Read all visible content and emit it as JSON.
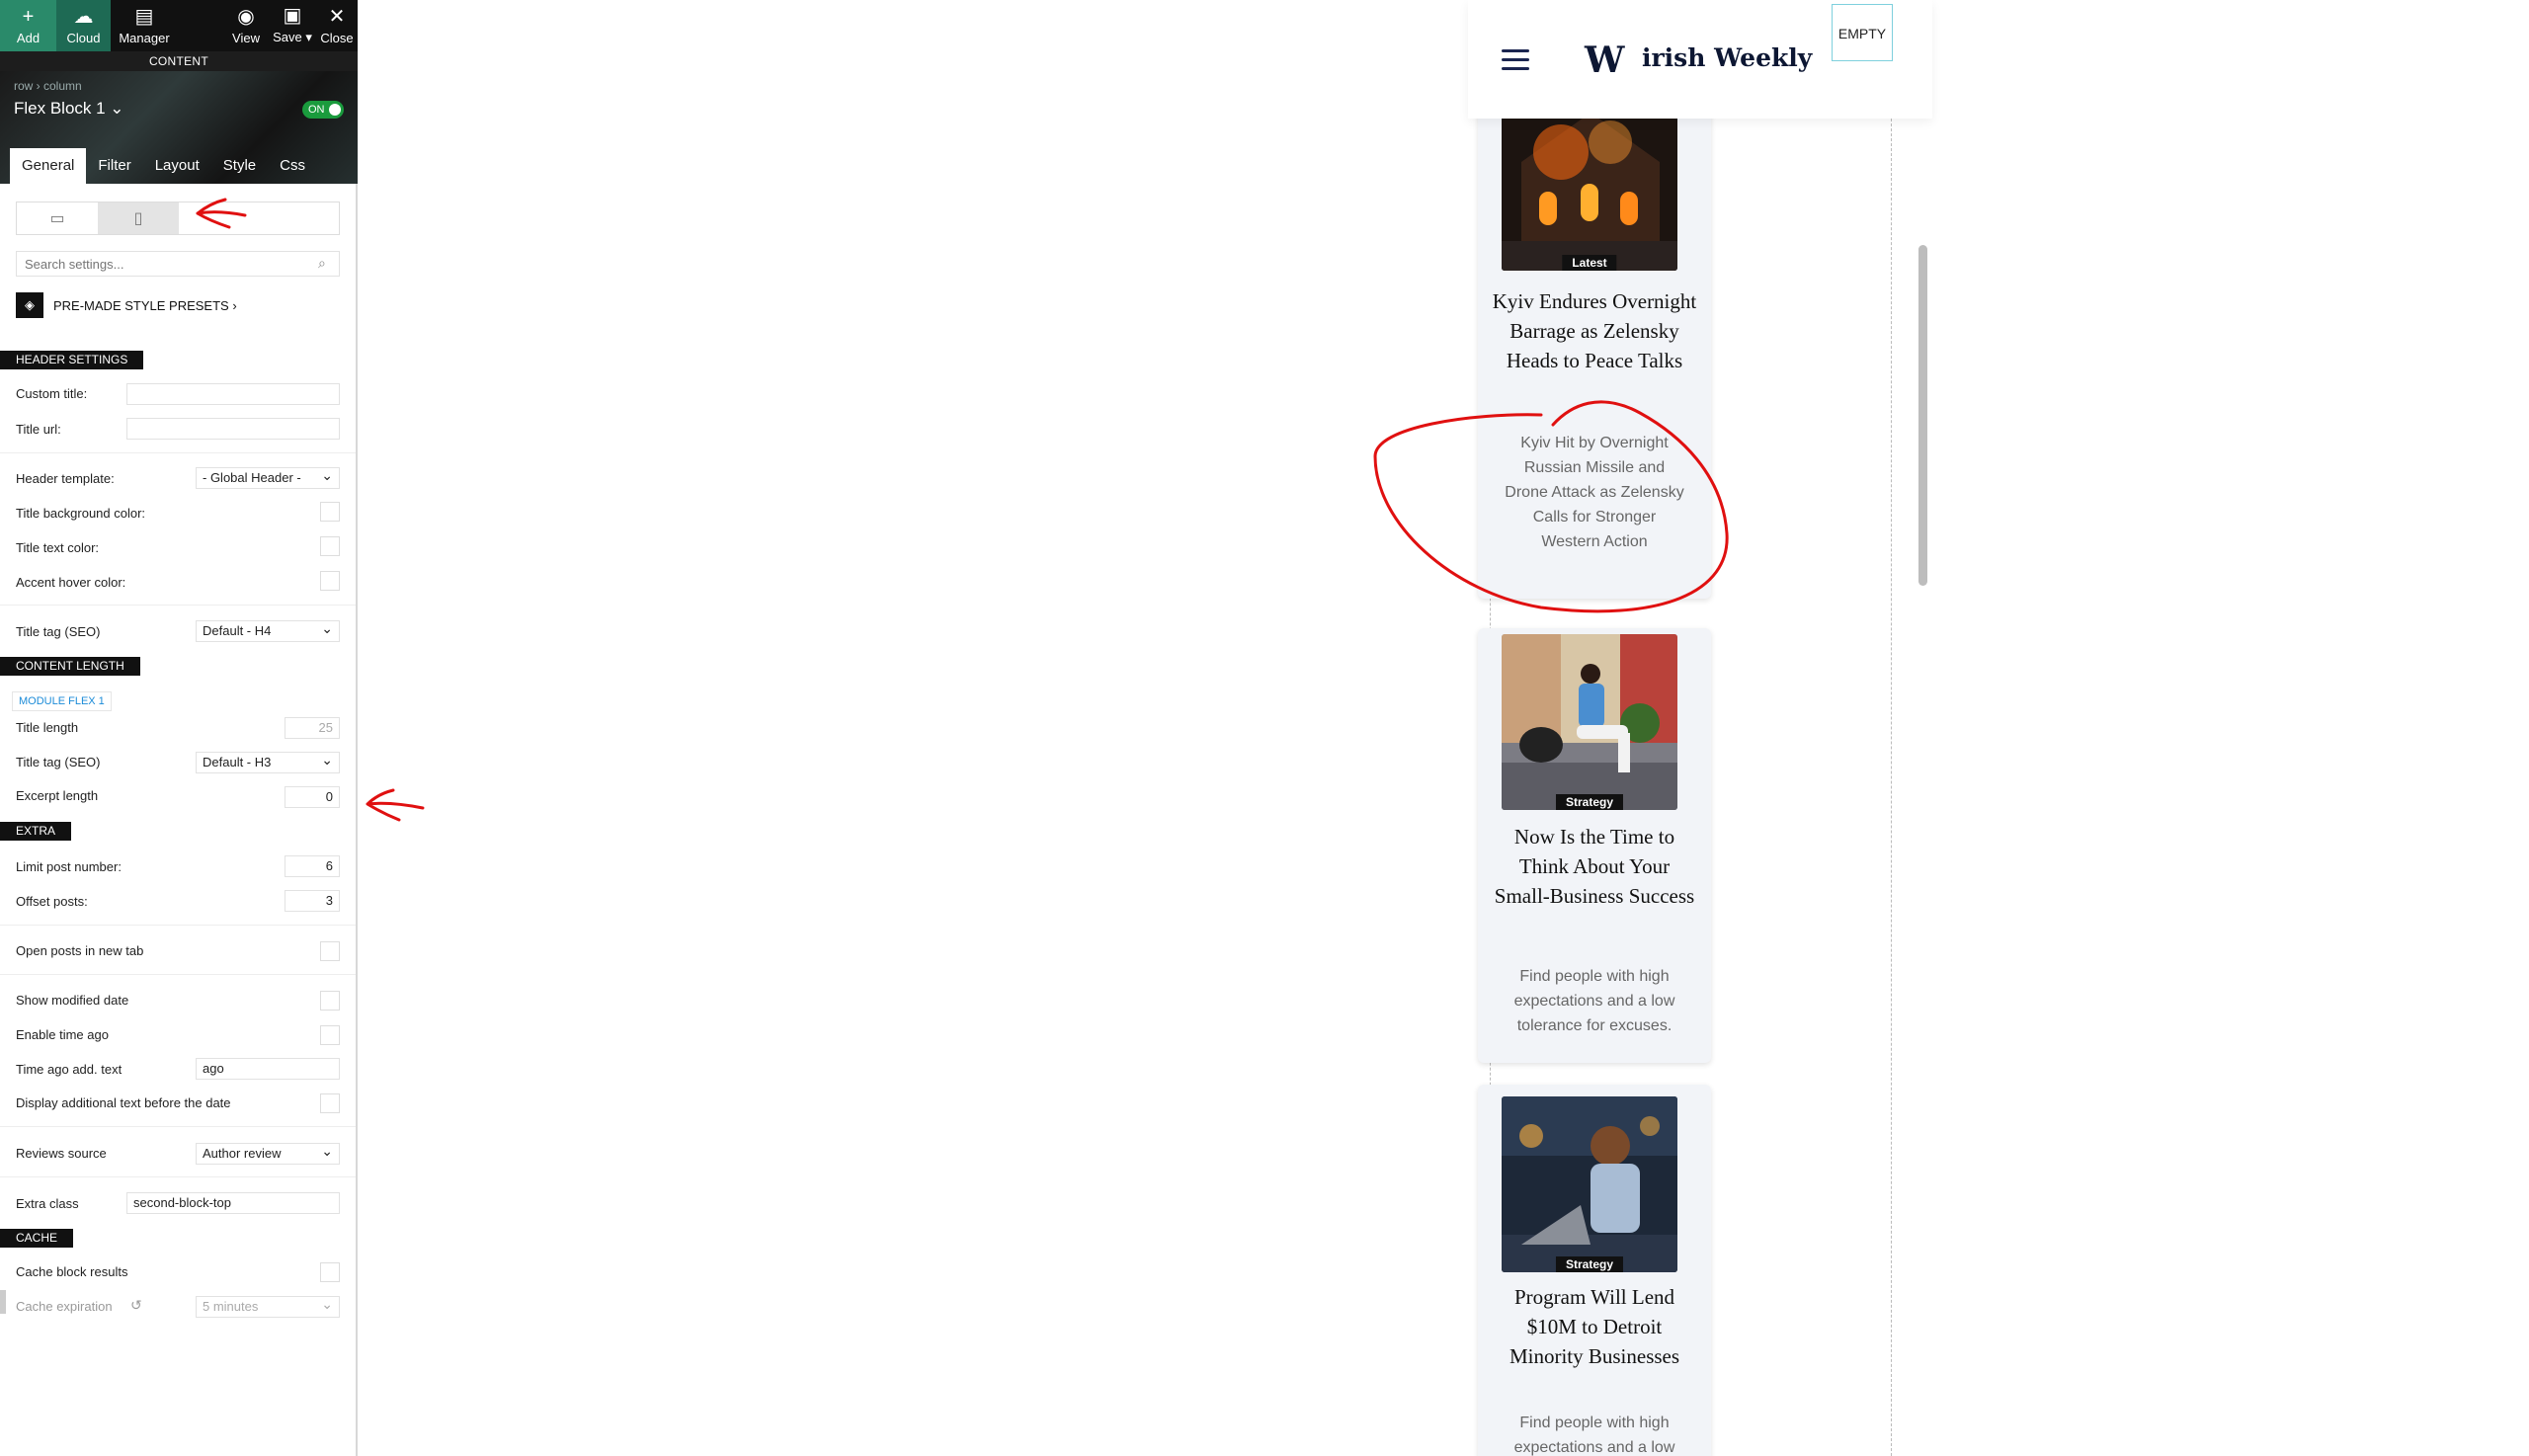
{
  "toolbar": {
    "add": "Add",
    "cloud": "Cloud",
    "manager": "Manager",
    "view": "View",
    "save": "Save ▾",
    "close": "Close",
    "content_band": "CONTENT"
  },
  "block": {
    "breadcrumb": "row › column",
    "title": "Flex Block 1 ⌄",
    "toggle": "ON"
  },
  "tabs": [
    "General",
    "Filter",
    "Layout",
    "Style",
    "Css"
  ],
  "search_placeholder": "Search settings...",
  "presets_label": "PRE-MADE STYLE PRESETS ›",
  "header_settings": {
    "heading": "HEADER SETTINGS",
    "custom_title": "Custom title:",
    "title_url": "Title url:",
    "header_template": "Header template:",
    "header_template_value": "- Global Header -",
    "title_bg": "Title background color:",
    "title_text": "Title text color:",
    "accent_hover": "Accent hover color:",
    "title_tag": "Title tag (SEO)",
    "title_tag_value": "Default - H4"
  },
  "content_length": {
    "heading": "CONTENT LENGTH",
    "module": "MODULE FLEX 1",
    "title_length": "Title length",
    "title_length_value": "25",
    "title_tag": "Title tag (SEO)",
    "title_tag_value": "Default - H3",
    "excerpt_length": "Excerpt length",
    "excerpt_length_value": "0"
  },
  "extra": {
    "heading": "EXTRA",
    "limit": "Limit post number:",
    "limit_value": "6",
    "offset": "Offset posts:",
    "offset_value": "3",
    "open_new_tab": "Open posts in new tab",
    "show_modified": "Show modified date",
    "enable_time_ago": "Enable time ago",
    "time_ago_text": "Time ago add. text",
    "time_ago_value": "ago",
    "display_additional": "Display additional text before the date",
    "reviews_source": "Reviews source",
    "reviews_value": "Author review",
    "extra_class": "Extra class",
    "extra_class_value": "second-block-top"
  },
  "cache": {
    "heading": "CACHE",
    "cache_results": "Cache block results",
    "cache_expiration": "Cache expiration",
    "cache_expiration_value": "5 minutes"
  },
  "site": {
    "logo_letter": "W",
    "logo_text": "irish Weekly",
    "empty": "EMPTY"
  },
  "posts": [
    {
      "badge": "Latest",
      "title": "Kyiv Endures Overnight Barrage as Zelensky Heads to Peace Talks",
      "excerpt": "Kyiv Hit by Overnight Russian Missile and Drone Attack as Zelensky Calls for Stronger Western Action"
    },
    {
      "badge": "Strategy",
      "title": "Now Is the Time to Think About Your Small-Business Success",
      "excerpt": "Find people with high expectations and a low tolerance for excuses."
    },
    {
      "badge": "Strategy",
      "title": "Program Will Lend $10M to Detroit Minority Businesses",
      "excerpt": "Find people with high expectations and a low"
    }
  ],
  "colors": {
    "toolbar": "#111111",
    "add_green": "#2a8a6a",
    "annotation_red": "#e01010",
    "card_bg": "#f2f4f8",
    "toggle_green": "#1a9b3d"
  }
}
